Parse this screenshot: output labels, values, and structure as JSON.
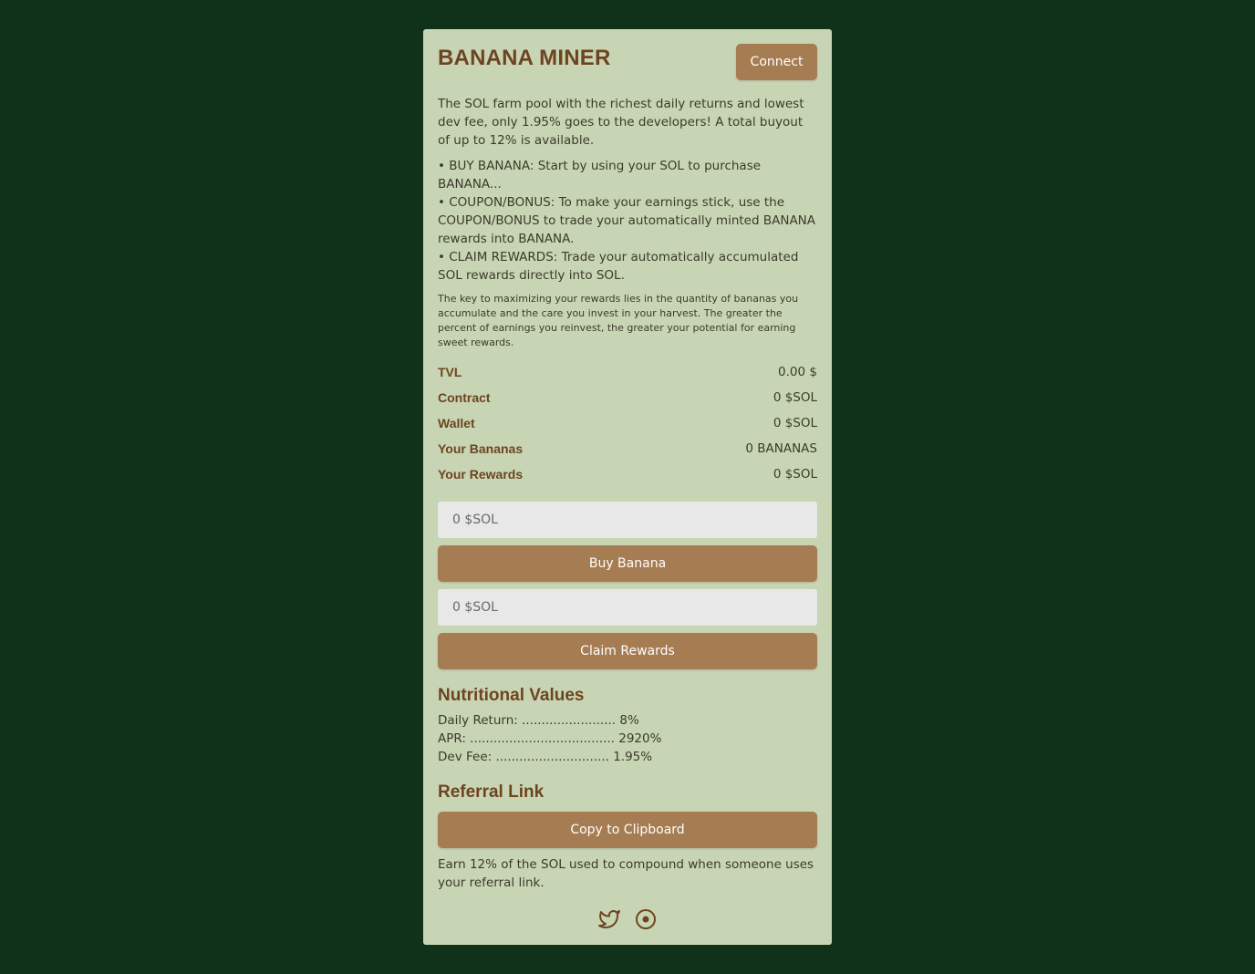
{
  "app": {
    "title": "BANANA MINER",
    "connect_label": "Connect"
  },
  "intro": "The SOL farm pool with the richest daily returns and lowest dev fee, only 1.95% goes to the developers! A total buyout of up to 12% is available.",
  "bullets": [
    "• BUY BANANA: Start by using your SOL to purchase BANANA...",
    "• COUPON/BONUS: To make your earnings stick, use the COUPON/BONUS to trade your automatically minted BANANA rewards into BANANA.",
    "• CLAIM REWARDS: Trade your automatically accumulated SOL rewards directly into SOL."
  ],
  "note": "The key to maximizing your rewards lies in the quantity of bananas you accumulate and the care you invest in your harvest. The greater the percent of earnings you reinvest, the greater your potential for earning sweet rewards.",
  "stats": [
    {
      "label": "TVL",
      "value": "0.00 $"
    },
    {
      "label": "Contract",
      "value": "0 $SOL"
    },
    {
      "label": "Wallet",
      "value": "0 $SOL"
    },
    {
      "label": "Your Bananas",
      "value": "0 BANANAS"
    },
    {
      "label": "Your Rewards",
      "value": "0 $SOL"
    }
  ],
  "buy": {
    "placeholder": "0 $SOL",
    "button_label": "Buy Banana"
  },
  "claim": {
    "placeholder": "0 $SOL",
    "button_label": "Claim Rewards"
  },
  "nutrition": {
    "heading": "Nutritional Values",
    "lines": [
      "Daily Return: ........................ 8%",
      "APR: ..................................... 2920%",
      "Dev Fee: ............................. 1.95%"
    ]
  },
  "referral": {
    "heading": "Referral Link",
    "button_label": "Copy to Clipboard",
    "description": "Earn 12% of the SOL used to compound when someone uses your referral link."
  },
  "footer": {
    "icons": [
      "twitter-icon",
      "target-icon"
    ]
  },
  "colors": {
    "background": "#10321b",
    "card": "#c8d5b4",
    "accent": "#a67c52",
    "heading": "#6e4420",
    "input": "#e8e8e8"
  }
}
